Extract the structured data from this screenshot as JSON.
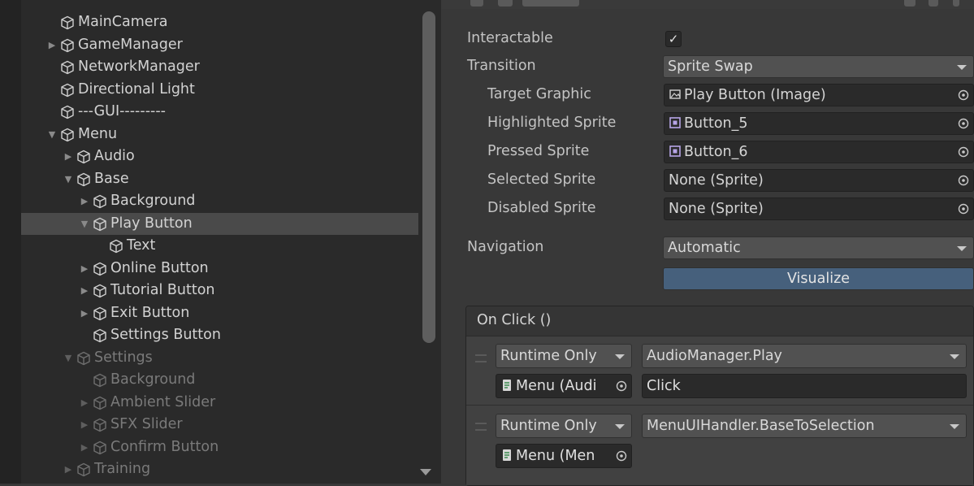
{
  "hierarchy": {
    "items": [
      {
        "label": "MainCamera",
        "depth": 0,
        "expander": "none",
        "state": "normal"
      },
      {
        "label": "GameManager",
        "depth": 0,
        "expander": "collapsed",
        "state": "normal"
      },
      {
        "label": "NetworkManager",
        "depth": 0,
        "expander": "none",
        "state": "normal"
      },
      {
        "label": "Directional Light",
        "depth": 0,
        "expander": "none",
        "state": "normal"
      },
      {
        "label": "---GUI---------",
        "depth": 0,
        "expander": "none",
        "state": "normal"
      },
      {
        "label": "Menu",
        "depth": 0,
        "expander": "expanded",
        "state": "normal"
      },
      {
        "label": "Audio",
        "depth": 1,
        "expander": "collapsed",
        "state": "normal"
      },
      {
        "label": "Base",
        "depth": 1,
        "expander": "expanded",
        "state": "normal"
      },
      {
        "label": "Background",
        "depth": 2,
        "expander": "collapsed",
        "state": "normal"
      },
      {
        "label": "Play Button",
        "depth": 2,
        "expander": "expanded",
        "state": "selected"
      },
      {
        "label": "Text",
        "depth": 3,
        "expander": "none",
        "state": "normal"
      },
      {
        "label": "Online Button",
        "depth": 2,
        "expander": "collapsed",
        "state": "normal"
      },
      {
        "label": "Tutorial Button",
        "depth": 2,
        "expander": "collapsed",
        "state": "normal"
      },
      {
        "label": "Exit Button",
        "depth": 2,
        "expander": "collapsed",
        "state": "normal"
      },
      {
        "label": "Settings Button",
        "depth": 2,
        "expander": "none",
        "state": "normal"
      },
      {
        "label": "Settings",
        "depth": 1,
        "expander": "expanded",
        "state": "disabled"
      },
      {
        "label": "Background",
        "depth": 2,
        "expander": "none",
        "state": "disabled"
      },
      {
        "label": "Ambient Slider",
        "depth": 2,
        "expander": "collapsed",
        "state": "disabled"
      },
      {
        "label": "SFX Slider",
        "depth": 2,
        "expander": "collapsed",
        "state": "disabled"
      },
      {
        "label": "Confirm Button",
        "depth": 2,
        "expander": "collapsed",
        "state": "disabled"
      },
      {
        "label": "Training",
        "depth": 1,
        "expander": "collapsed",
        "state": "disabled"
      }
    ]
  },
  "inspector": {
    "interactable_label": "Interactable",
    "interactable_checked": true,
    "transition_label": "Transition",
    "transition_value": "Sprite Swap",
    "target_graphic_label": "Target Graphic",
    "target_graphic_value": "Play Button (Image)",
    "highlighted_label": "Highlighted Sprite",
    "highlighted_value": "Button_5",
    "pressed_label": "Pressed Sprite",
    "pressed_value": "Button_6",
    "selected_label": "Selected Sprite",
    "selected_value": "None (Sprite)",
    "disabled_label": "Disabled Sprite",
    "disabled_value": "None (Sprite)",
    "navigation_label": "Navigation",
    "navigation_value": "Automatic",
    "visualize_label": "Visualize"
  },
  "on_click": {
    "header": "On Click ()",
    "entries": [
      {
        "mode": "Runtime Only",
        "function": "AudioManager.Play",
        "target": "Menu (Audi",
        "argument": "Click"
      },
      {
        "mode": "Runtime Only",
        "function": "MenuUIHandler.BaseToSelection",
        "target": "Menu (Men",
        "argument": ""
      }
    ]
  },
  "colors": {
    "hierarchy_bg": "#2a2a2a",
    "inspector_bg": "#383838",
    "selection_bg": "#4a4a4a",
    "visualize_bg": "#46607c"
  }
}
